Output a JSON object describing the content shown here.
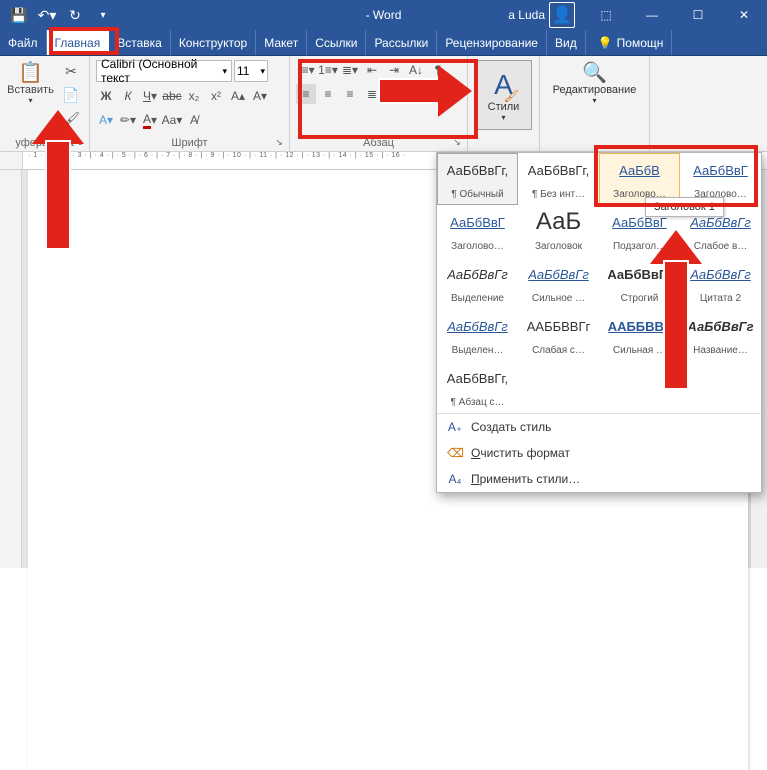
{
  "titlebar": {
    "app_title": "- Word",
    "user_name": "a Luda"
  },
  "tabs": {
    "file": "Файл",
    "home": "Главная",
    "insert": "Вставка",
    "design": "Конструктор",
    "layout": "Макет",
    "references": "Ссылки",
    "mailings": "Рассылки",
    "review": "Рецензирование",
    "view": "Вид",
    "help": "Помощн"
  },
  "ribbon": {
    "clipboard": {
      "paste": "Вставить",
      "group": "уферьмана"
    },
    "font": {
      "name": "Calibri (Основной текст",
      "size": "11",
      "group": "Шрифт"
    },
    "paragraph": {
      "group": "Абзац"
    },
    "styles": {
      "button": "Стили"
    },
    "editing": {
      "button": "Редактирование"
    }
  },
  "gallery": {
    "tooltip": "Заголовок 1",
    "styles": [
      {
        "preview": "АаБбВвГг,",
        "caption": "¶ Обычный",
        "cls": "sel"
      },
      {
        "preview": "АаБбВвГг,",
        "caption": "¶ Без инт…",
        "cls": ""
      },
      {
        "preview": "АаБбВ",
        "caption": "Заголово…",
        "cls": "hover blue"
      },
      {
        "preview": "АаБбВвГ",
        "caption": "Заголово…",
        "cls": "blue"
      },
      {
        "preview": "АаБбВвГ",
        "caption": "Заголово…",
        "cls": "blue"
      },
      {
        "preview": "АаБ",
        "caption": "Заголовок",
        "cls": "big"
      },
      {
        "preview": "АаБбВвГ",
        "caption": "Подзагол…",
        "cls": "blue"
      },
      {
        "preview": "АаБбВвГг",
        "caption": "Слабое в…",
        "cls": "blue ital"
      },
      {
        "preview": "АаБбВвГг",
        "caption": "Выделение",
        "cls": "ital"
      },
      {
        "preview": "АаБбВвГг",
        "caption": "Сильное …",
        "cls": "blue ital"
      },
      {
        "preview": "АаБбВвГг",
        "caption": "Строгий",
        "cls": "bold"
      },
      {
        "preview": "АаБбВвГг",
        "caption": "Цитата 2",
        "cls": "blue ital"
      },
      {
        "preview": "АаБбВвГг",
        "caption": "Выделен…",
        "cls": "blue ital u"
      },
      {
        "preview": "ААББВВГг",
        "caption": "Слабая с…",
        "cls": ""
      },
      {
        "preview": "ААББВВГ",
        "caption": "Сильная …",
        "cls": "blue bold"
      },
      {
        "preview": "АаБбВвГг",
        "caption": "Название…",
        "cls": "bold ital"
      },
      {
        "preview": "АаБбВвГг,",
        "caption": "¶ Абзац с…",
        "cls": ""
      }
    ],
    "footer": {
      "create": "Создать стиль",
      "clear": "Очистить формат",
      "apply": "Применить стили…"
    }
  },
  "ruler_text": "· 1 · | · 2 · | · 3 · | · 4 · | · 5 · | · 6 · | · 7 · | · 8 · | · 9 · | · 10 · | · 11 · | · 12 · | · 13 · | · 14 · | · 15 · | · 16 ·"
}
